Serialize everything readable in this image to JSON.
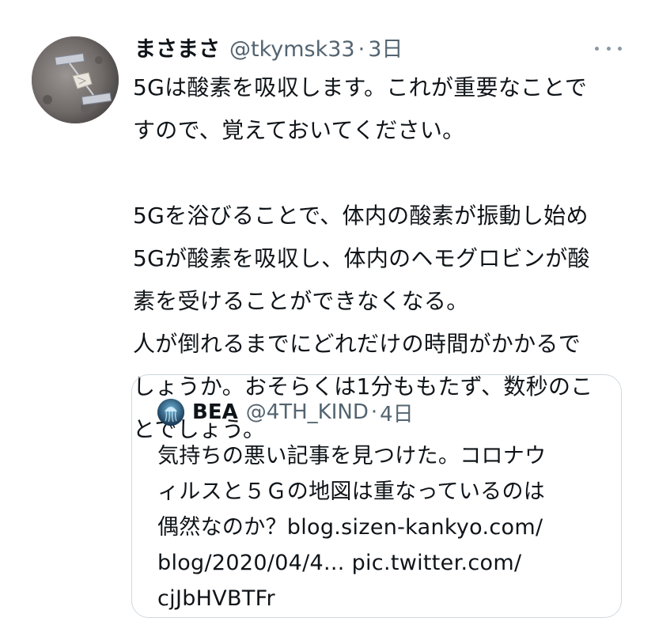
{
  "tweet": {
    "display_name": "まさまさ",
    "handle": "@tkymsk33",
    "separator": "·",
    "time": "3日",
    "more_icon": "more-horizontal-icon",
    "avatar_icon": "asteroid-probe-avatar",
    "body_lines": [
      "5Gは酸素を吸収します。これが重要なことで",
      "すので、覚えておいてください。",
      "",
      "5Gを浴びることで、体内の酸素が振動し始め",
      "5Gが酸素を吸収し、体内のヘモグロビンが酸",
      "素を受けることができなくなる。",
      "人が倒れるまでにどれだけの時間がかかるで",
      "しょうか。おそらくは1分ももたず、数秒のこ",
      "とでしょう。"
    ]
  },
  "quote": {
    "display_name": "BEA",
    "handle": "@4TH_KIND",
    "separator": "·",
    "time": "4日",
    "avatar_icon": "jellyfish-avatar",
    "text_lines": [
      "気持ちの悪い記事を見つけた。コロナウ",
      "ィルスと５Ｇの地図は重なっているのは",
      "偶然なのか？blog.sizen-kankyo.com/",
      "blog/2020/04/4... pic.twitter.com/",
      "cjJbHVBTFr"
    ]
  },
  "colors": {
    "text": "#0f1419",
    "secondary": "#536471",
    "border": "#cfd9de",
    "background": "#ffffff"
  }
}
